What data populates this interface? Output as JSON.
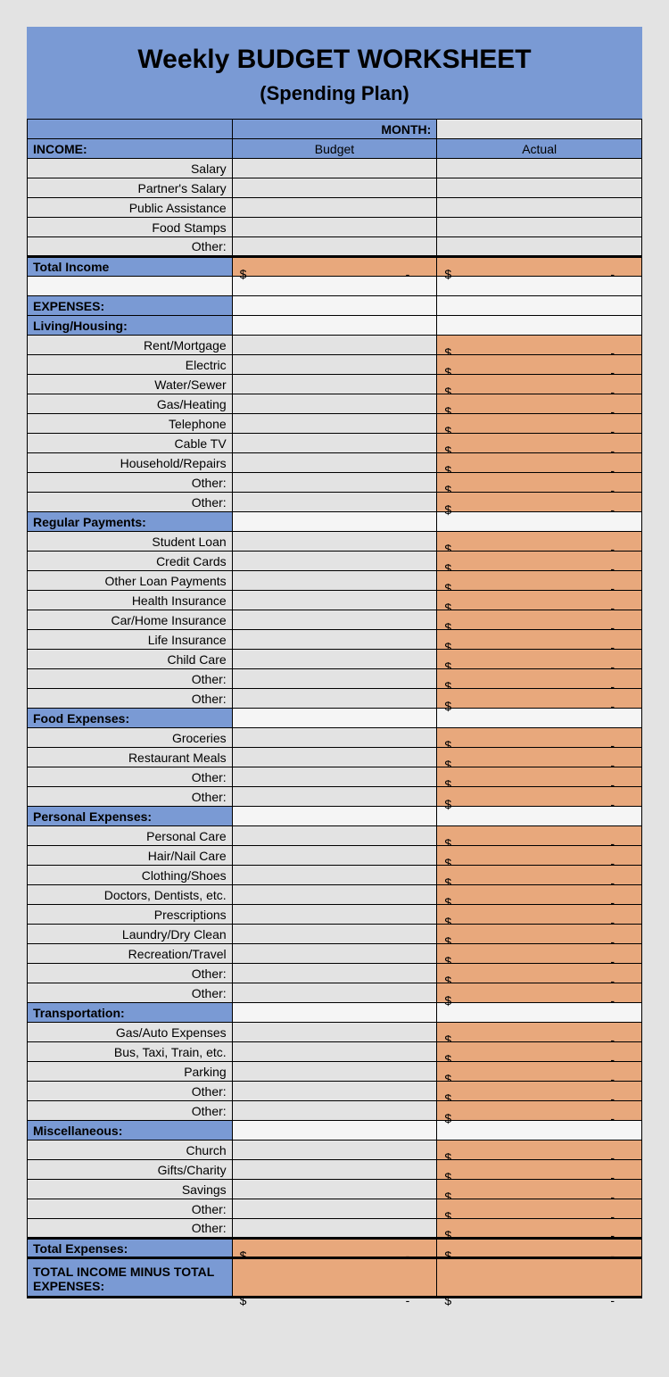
{
  "title": "Weekly BUDGET WORKSHEET",
  "subtitle": "(Spending Plan)",
  "month_label": "MONTH:",
  "col_budget": "Budget",
  "col_actual": "Actual",
  "income_h": "INCOME:",
  "income": [
    "Salary",
    "Partner's Salary",
    "Public Assistance",
    "Food Stamps",
    "Other:"
  ],
  "total_income": "Total Income",
  "expenses_h": "EXPENSES:",
  "s1": "Living/Housing:",
  "s1r": [
    "Rent/Mortgage",
    "Electric",
    "Water/Sewer",
    "Gas/Heating",
    "Telephone",
    "Cable TV",
    "Household/Repairs",
    "Other:",
    "Other:"
  ],
  "s2": "Regular Payments:",
  "s2r": [
    "Student Loan",
    "Credit Cards",
    "Other Loan Payments",
    "Health Insurance",
    "Car/Home Insurance",
    "Life Insurance",
    "Child Care",
    "Other:",
    "Other:"
  ],
  "s3": "Food Expenses:",
  "s3r": [
    "Groceries",
    "Restaurant Meals",
    "Other:",
    "Other:"
  ],
  "s4": "Personal Expenses:",
  "s4r": [
    "Personal Care",
    "Hair/Nail Care",
    "Clothing/Shoes",
    "Doctors, Dentists, etc.",
    "Prescriptions",
    "Laundry/Dry Clean",
    "Recreation/Travel",
    "Other:",
    "Other:"
  ],
  "s5": "Transportation:",
  "s5r": [
    "Gas/Auto Expenses",
    "Bus, Taxi, Train, etc.",
    "Parking",
    "Other:",
    "Other:"
  ],
  "s6": "Miscellaneous:",
  "s6r": [
    "Church",
    "Gifts/Charity",
    "Savings",
    "Other:",
    "Other:"
  ],
  "total_exp": "Total Expenses:",
  "net": "TOTAL INCOME MINUS TOTAL EXPENSES:",
  "ds": "$",
  "dh": "-"
}
